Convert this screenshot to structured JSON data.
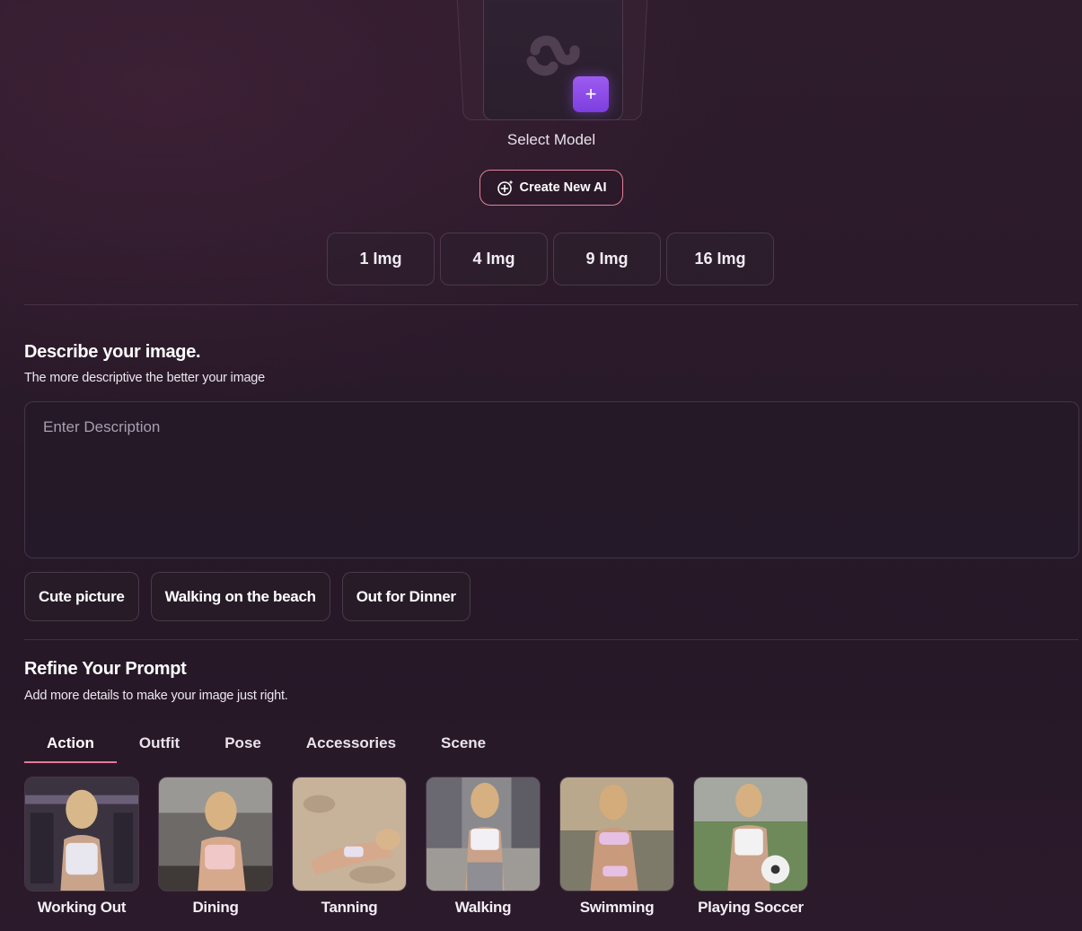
{
  "model": {
    "select_label": "Select Model",
    "add_label": "+"
  },
  "create_button": {
    "label": "Create New AI",
    "icon": "sparkle-plus-icon"
  },
  "image_counts": [
    "1 Img",
    "4 Img",
    "9 Img",
    "16 Img"
  ],
  "describe": {
    "title": "Describe your image.",
    "subtitle": "The more descriptive the better your image",
    "placeholder": "Enter Description",
    "value": ""
  },
  "suggestions": [
    "Cute picture",
    "Walking on the beach",
    "Out for Dinner"
  ],
  "refine": {
    "title": "Refine Your Prompt",
    "subtitle": "Add more details to make your image just right.",
    "tabs": [
      "Action",
      "Outfit",
      "Pose",
      "Accessories",
      "Scene"
    ],
    "active_tab": "Action",
    "options": [
      {
        "label": "Working Out"
      },
      {
        "label": "Dining"
      },
      {
        "label": "Tanning"
      },
      {
        "label": "Walking"
      },
      {
        "label": "Swimming"
      },
      {
        "label": "Playing Soccer"
      }
    ]
  },
  "colors": {
    "accent_pink": "#e57998",
    "accent_purple": "#8b4ae8",
    "background": "#2a1a2a"
  }
}
